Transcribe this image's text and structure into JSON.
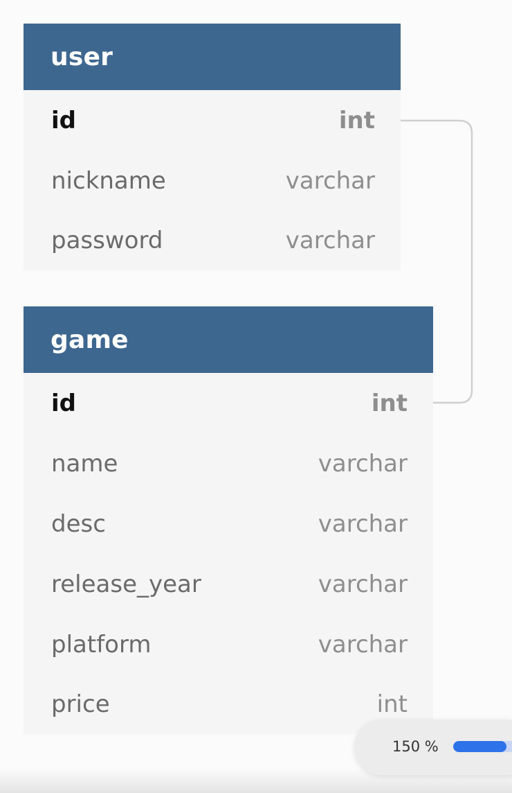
{
  "tables": [
    {
      "name": "user",
      "fields": [
        {
          "name": "id",
          "type": "int",
          "primary": true
        },
        {
          "name": "nickname",
          "type": "varchar",
          "primary": false
        },
        {
          "name": "password",
          "type": "varchar",
          "primary": false
        }
      ]
    },
    {
      "name": "game",
      "fields": [
        {
          "name": "id",
          "type": "int",
          "primary": true
        },
        {
          "name": "name",
          "type": "varchar",
          "primary": false
        },
        {
          "name": "desc",
          "type": "varchar",
          "primary": false
        },
        {
          "name": "release_year",
          "type": "varchar",
          "primary": false
        },
        {
          "name": "platform",
          "type": "varchar",
          "primary": false
        },
        {
          "name": "price",
          "type": "int",
          "primary": false
        }
      ]
    }
  ],
  "relationships": [
    {
      "from": "user.id",
      "to": "game.id"
    }
  ],
  "zoom": {
    "label": "150 %",
    "slider_level": 0.7
  },
  "colors": {
    "table_header": "#3e6790",
    "table_body": "#f5f5f5",
    "connector": "#cfcfcf",
    "slider_accent": "#2d72e8"
  }
}
